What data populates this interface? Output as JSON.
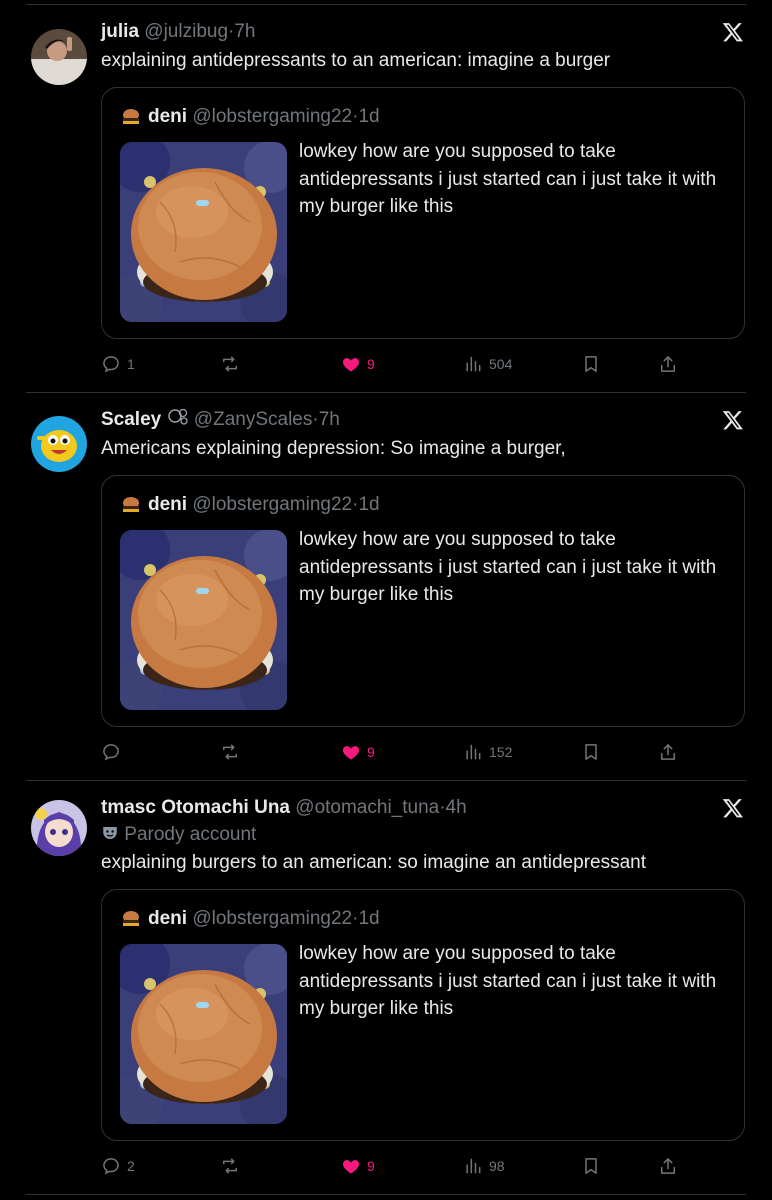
{
  "tweets": [
    {
      "name": "julia",
      "handle": "@julzibug",
      "sep": "·",
      "time": "7h",
      "parody": "",
      "text": "explaining antidepressants to an american: imagine a burger",
      "quote": {
        "name": "deni",
        "handle": "@lobstergaming22",
        "sep": "·",
        "time": "1d",
        "text": "lowkey how are you supposed to take antidepressants i just started can i just take it with my burger like this"
      },
      "replies": "1",
      "reposts": "",
      "likes": "9",
      "views": "504"
    },
    {
      "name": "Scaley",
      "handle": "@ZanyScales",
      "sep": "·",
      "time": "7h",
      "parody": "",
      "text": "Americans explaining depression: So imagine a burger,",
      "quote": {
        "name": "deni",
        "handle": "@lobstergaming22",
        "sep": "·",
        "time": "1d",
        "text": "lowkey how are you supposed to take antidepressants i just started can i just take it with my burger like this"
      },
      "replies": "",
      "reposts": "",
      "likes": "9",
      "views": "152"
    },
    {
      "name": "tmasc Otomachi Una",
      "handle": "@otomachi_tuna",
      "sep": "·",
      "time": "4h",
      "parody": "Parody account",
      "text": "explaining burgers to an american: so imagine an antidepressant",
      "quote": {
        "name": "deni",
        "handle": "@lobstergaming22",
        "sep": "·",
        "time": "1d",
        "text": "lowkey how are you supposed to take antidepressants i just started can i just take it with my burger like this"
      },
      "replies": "2",
      "reposts": "",
      "likes": "9",
      "views": "98"
    }
  ],
  "icons": {
    "close": "x-logo-icon",
    "reply": "reply-icon",
    "repost": "repost-icon",
    "like": "heart-icon",
    "views": "views-icon",
    "bookmark": "bookmark-icon",
    "share": "share-icon",
    "parody": "parody-mask-icon"
  },
  "colors": {
    "background": "#000000",
    "text": "#e7e9ea",
    "muted": "#71767b",
    "border": "#2f3336",
    "like": "#f91880"
  }
}
